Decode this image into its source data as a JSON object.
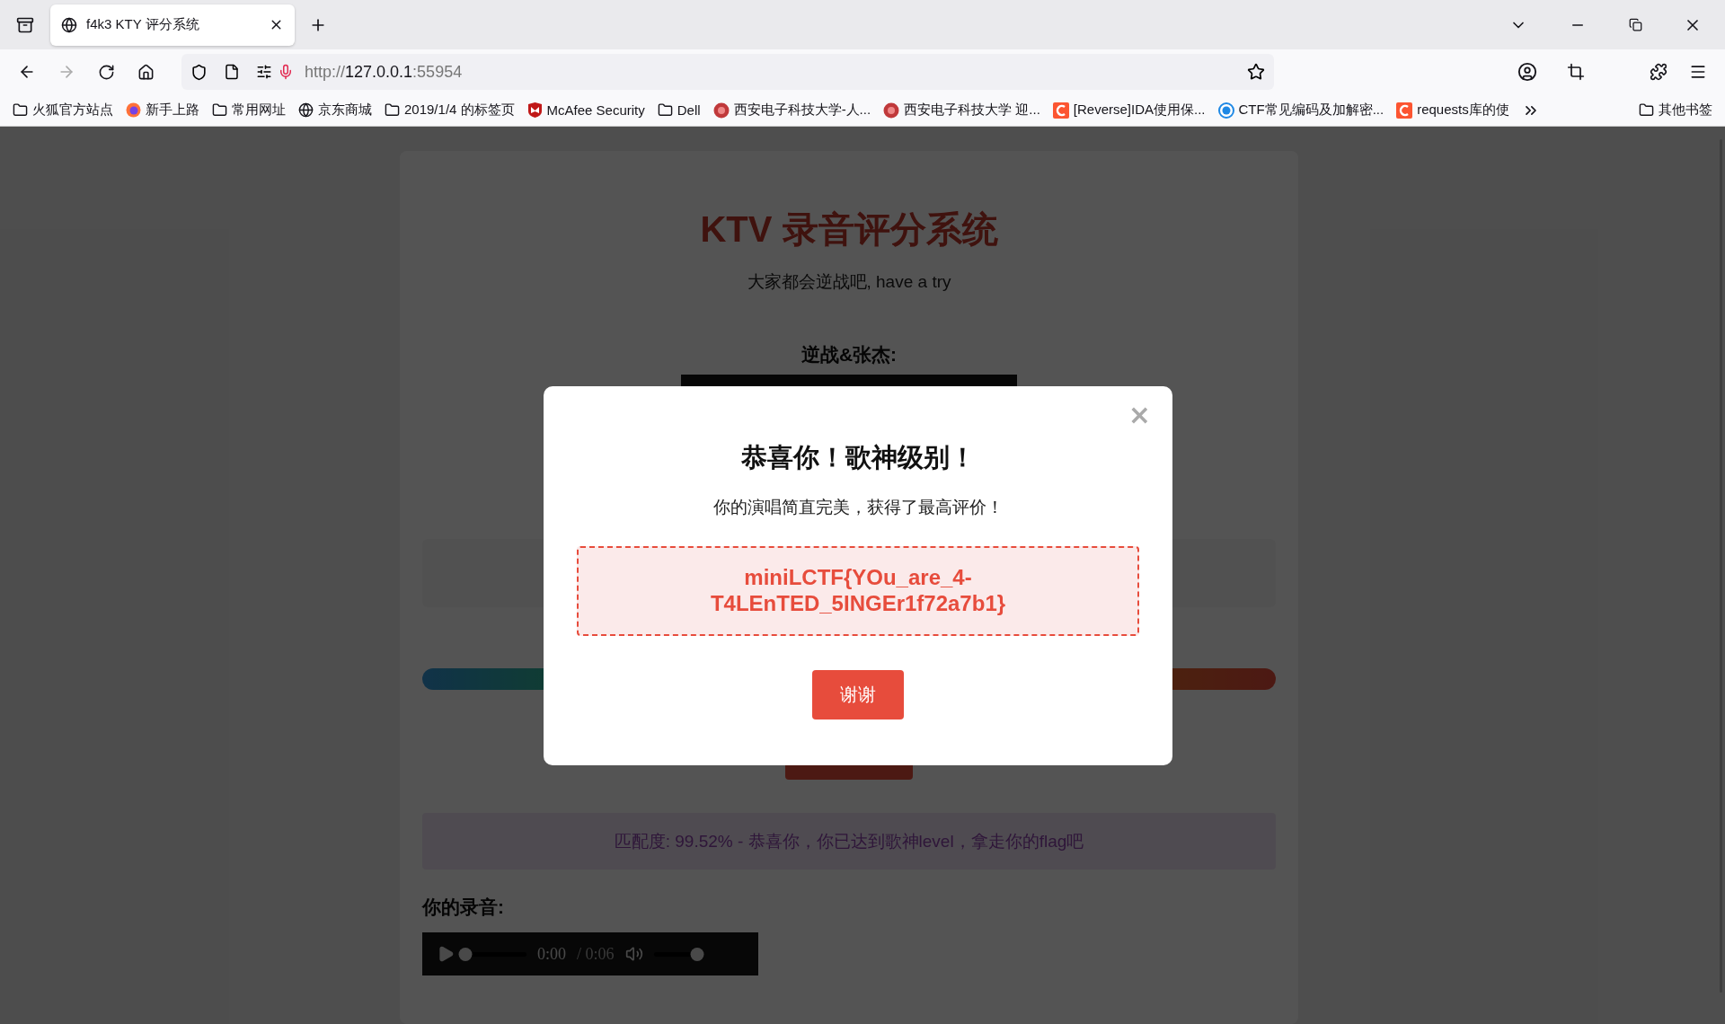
{
  "browser": {
    "tabs": [
      {
        "title": "f4k3 KTY 评分系统",
        "selected": true
      }
    ],
    "url": {
      "scheme": "http://",
      "host": "127.0.0.1",
      "port": ":55954"
    },
    "bookmarks": [
      {
        "kind": "folder",
        "label": "火狐官方站点"
      },
      {
        "kind": "firefox",
        "label": "新手上路"
      },
      {
        "kind": "folder",
        "label": "常用网址"
      },
      {
        "kind": "globe",
        "label": "京东商城"
      },
      {
        "kind": "folder",
        "label": "2019/1/4 的标签页"
      },
      {
        "kind": "shield",
        "label": "McAfee Security"
      },
      {
        "kind": "folder",
        "label": "Dell"
      },
      {
        "kind": "emblem",
        "label": "西安电子科技大学-人..."
      },
      {
        "kind": "emblem",
        "label": "西安电子科技大学 迎..."
      },
      {
        "kind": "csdn",
        "label": "[Reverse]IDA使用保..."
      },
      {
        "kind": "ctf",
        "label": "CTF常见编码及加解密..."
      },
      {
        "kind": "csdn",
        "label": "requests库的使"
      }
    ],
    "other_bookmarks": "其他书签"
  },
  "page": {
    "title": "KTV 录音评分系统",
    "subtitle": "大家都会逆战吧, have a try",
    "song_label": "逆战&张杰:",
    "result": "匹配度: 99.52% - 恭喜你，你已达到歌神level，拿走你的flag吧",
    "recording_label": "你的录音:",
    "recording_player": {
      "current": "0:00",
      "duration": "/ 0:06",
      "level": 0,
      "volume_slider": {
        "level": 1
      }
    }
  },
  "modal": {
    "close": "×",
    "title": "恭喜你！歌神级别！",
    "message": "你的演唱简直完美，获得了最高评价！",
    "flag": "miniLCTF{YOu_are_4-T4LEnTED_5INGEr1f72a7b1}",
    "button": "谢谢"
  }
}
